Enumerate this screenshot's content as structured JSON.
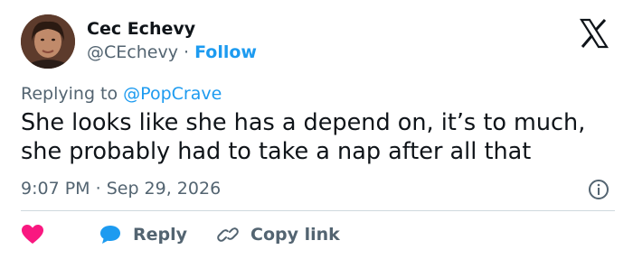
{
  "tweet": {
    "author_name": "Cec Echevy",
    "author_handle": "@CEchevy",
    "separator": "·",
    "follow_label": "Follow",
    "replying_prefix": "Replying to",
    "replying_to": "@PopCrave",
    "text_line1": "She looks like she has a depend on, it’s to much,",
    "text_line2": "she probably had to take a nap after all that",
    "time": "9:07 PM",
    "date": "Sep 29, 2026"
  },
  "actions": {
    "like_icon": "heart-icon",
    "reply_icon": "speech-bubble-icon",
    "reply_label": "Reply",
    "copy_icon": "link-icon",
    "copy_label": "Copy link"
  },
  "colors": {
    "accent": "#1d9bf0",
    "like": "#f91880",
    "muted": "#536471",
    "text": "#0f1419"
  }
}
